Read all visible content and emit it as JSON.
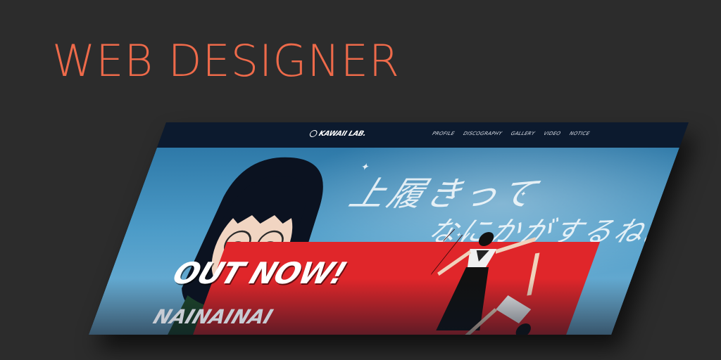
{
  "headline": "WEB DESIGNER",
  "site": {
    "logo_text": "KAWAII LAB.",
    "nav": [
      "PROFILE",
      "DISCOGRAPHY",
      "GALLERY",
      "VIDEO",
      "NOTICE"
    ],
    "hero": {
      "copy_line1": "上履きって",
      "copy_line2": "なにかがするね。",
      "banner_heading": "OUT NOW!",
      "release_title": "NAINAINAI"
    }
  },
  "colors": {
    "background": "#2c2c2c",
    "headline": "#ee6a4a",
    "nav_bar": "#0c1a2e",
    "banner_red": "#e0262a",
    "sky": "#4d9cc8"
  }
}
